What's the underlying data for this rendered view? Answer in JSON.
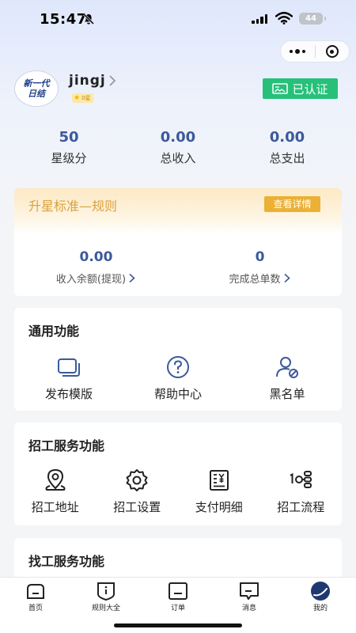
{
  "status_bar": {
    "time": "15:47",
    "battery": "44"
  },
  "profile": {
    "avatar_line1": "新一代",
    "avatar_line2": "日结",
    "username": "jingj",
    "level_badge": "0星",
    "verified_label": "已认证"
  },
  "stats": [
    {
      "value": "50",
      "label": "星级分"
    },
    {
      "value": "0.00",
      "label": "总收入"
    },
    {
      "value": "0.00",
      "label": "总支出"
    }
  ],
  "promo": {
    "title": "升星标准—规则",
    "button": "查看详情",
    "items": [
      {
        "value": "0.00",
        "label": "收入余额(提现)"
      },
      {
        "value": "0",
        "label": "完成总单数"
      }
    ]
  },
  "general": {
    "title": "通用功能",
    "items": [
      {
        "label": "发布模版",
        "icon": "template-icon"
      },
      {
        "label": "帮助中心",
        "icon": "help-icon"
      },
      {
        "label": "黑名单",
        "icon": "blacklist-icon"
      }
    ]
  },
  "recruit": {
    "title": "招工服务功能",
    "items": [
      {
        "label": "招工地址",
        "icon": "location-icon"
      },
      {
        "label": "招工设置",
        "icon": "settings-icon"
      },
      {
        "label": "支付明细",
        "icon": "payment-detail-icon"
      },
      {
        "label": "招工流程",
        "icon": "process-icon"
      }
    ]
  },
  "findwork": {
    "title": "找工服务功能"
  },
  "tabbar": [
    {
      "label": "首页",
      "icon": "home-icon"
    },
    {
      "label": "规则大全",
      "icon": "rules-icon"
    },
    {
      "label": "订单",
      "icon": "order-icon"
    },
    {
      "label": "消息",
      "icon": "message-icon"
    },
    {
      "label": "我的",
      "icon": "profile-icon"
    }
  ],
  "colors": {
    "accent": "#3b5a9a",
    "verified": "#27c07a",
    "promo_button": "#ebb034",
    "promo_title": "#d9a23d"
  }
}
